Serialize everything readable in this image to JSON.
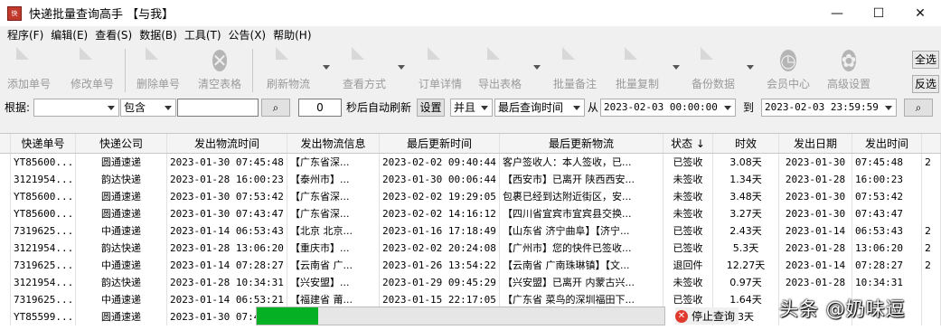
{
  "window": {
    "title": "快递批量查询高手 【与我】",
    "min_glyph": "—",
    "max_glyph": "☐",
    "close_glyph": "✕"
  },
  "menu": [
    "程序(F)",
    "编辑(E)",
    "查看(S)",
    "数据(B)",
    "工具(T)",
    "公告(X)",
    "帮助(H)"
  ],
  "toolbar": {
    "add": "添加单号",
    "edit": "修改单号",
    "delete": "删除单号",
    "clear": "清空表格",
    "refresh": "刷新物流",
    "view": "查看方式",
    "detail": "订单详情",
    "export": "导出表格",
    "batch_note": "批量备注",
    "batch_copy": "批量复制",
    "backup": "备份数据",
    "member": "会员中心",
    "advanced": "高级设置",
    "select_all": "全选",
    "invert": "反选"
  },
  "filter": {
    "by_label": "根据:",
    "by_value": "",
    "op_value": "包含",
    "keyword": "",
    "interval_value": "0",
    "auto_refresh_label": "秒后自动刷新",
    "set_button": "设置",
    "logic_value": "并且",
    "time_field_value": "最后查询时间",
    "from_label": "从",
    "from_value": "2023-02-03 00:00:00",
    "to_label": "到",
    "to_value": "2023-02-03 23:59:59"
  },
  "grid": {
    "headers": [
      "快递单号",
      "快递公司",
      "发出物流时间",
      "发出物流信息",
      "最后更新时间",
      "最后更新物流",
      "状态 ↓",
      "时效",
      "发出日期",
      "发出时间"
    ],
    "rows": [
      {
        "no": "YT85600...",
        "co": "圆通速递",
        "send_time": "2023-01-30 07:45:48",
        "send_info": "【广东省深...",
        "last_time": "2023-02-02 09:40:44",
        "last_info": "客户签收人：本人签收，已...",
        "status": "已签收",
        "dur": "3.08天",
        "date": "2023-01-30",
        "time": "07:45:48",
        "extra": "2"
      },
      {
        "no": "3121954...",
        "co": "韵达快递",
        "send_time": "2023-01-28 16:00:23",
        "send_info": "【泰州市】...",
        "last_time": "2023-01-30 00:06:44",
        "last_info": "【西安市】已离开 陕西西安...",
        "status": "未签收",
        "dur": "1.34天",
        "date": "2023-01-28",
        "time": "16:00:23",
        "extra": ""
      },
      {
        "no": "YT85600...",
        "co": "圆通速递",
        "send_time": "2023-01-30 07:53:42",
        "send_info": "【广东省深...",
        "last_time": "2023-02-02 19:29:05",
        "last_info": "包裹已经到达附近街区，安...",
        "status": "未签收",
        "dur": "3.48天",
        "date": "2023-01-30",
        "time": "07:53:42",
        "extra": ""
      },
      {
        "no": "YT85600...",
        "co": "圆通速递",
        "send_time": "2023-01-30 07:43:47",
        "send_info": "【广东省深...",
        "last_time": "2023-02-02 14:16:12",
        "last_info": "【四川省宜宾市宜宾县交换...",
        "status": "未签收",
        "dur": "3.27天",
        "date": "2023-01-30",
        "time": "07:43:47",
        "extra": ""
      },
      {
        "no": "7319625...",
        "co": "中通速递",
        "send_time": "2023-01-14 06:53:43",
        "send_info": "【北京 北京...",
        "last_time": "2023-01-16 17:18:49",
        "last_info": "【山东省 济宁曲阜】【济宁...",
        "status": "已签收",
        "dur": "2.43天",
        "date": "2023-01-14",
        "time": "06:53:43",
        "extra": "2"
      },
      {
        "no": "3121954...",
        "co": "韵达快递",
        "send_time": "2023-01-28 13:06:20",
        "send_info": "【重庆市】...",
        "last_time": "2023-02-02 20:24:08",
        "last_info": "【广州市】您的快件已签收...",
        "status": "已签收",
        "dur": "5.3天",
        "date": "2023-01-28",
        "time": "13:06:20",
        "extra": "2"
      },
      {
        "no": "7319625...",
        "co": "中通速递",
        "send_time": "2023-01-14 07:28:27",
        "send_info": "【云南省 广...",
        "last_time": "2023-01-26 13:54:22",
        "last_info": "【云南省 广南珠琳镇】【文...",
        "status": "退回件",
        "dur": "12.27天",
        "date": "2023-01-14",
        "time": "07:28:27",
        "extra": "2"
      },
      {
        "no": "3121954...",
        "co": "韵达快递",
        "send_time": "2023-01-28 10:34:31",
        "send_info": "【兴安盟】...",
        "last_time": "2023-01-29 09:45:29",
        "last_info": "【兴安盟】已离开 内蒙古兴...",
        "status": "未签收",
        "dur": "0.97天",
        "date": "2023-01-28",
        "time": "10:34:31",
        "extra": ""
      },
      {
        "no": "7319625...",
        "co": "中通速递",
        "send_time": "2023-01-14 06:53:21",
        "send_info": "【福建省 莆...",
        "last_time": "2023-01-15 22:17:05",
        "last_info": "【广东省 菜鸟的深圳福田下...",
        "status": "已签收",
        "dur": "1.64天",
        "date": "",
        "time": "",
        "extra": ""
      },
      {
        "no": "YT85599...",
        "co": "圆通速递",
        "send_time": "2023-01-30 07:4",
        "send_info": "",
        "last_time": "",
        "last_info": "",
        "status": "",
        "dur": "3天",
        "date": "",
        "time": "",
        "extra": ""
      }
    ]
  },
  "progress": {
    "value": 0.15,
    "color": "#06b025",
    "stop_label": "停止查询"
  },
  "watermark": "头条 @奶味逗"
}
